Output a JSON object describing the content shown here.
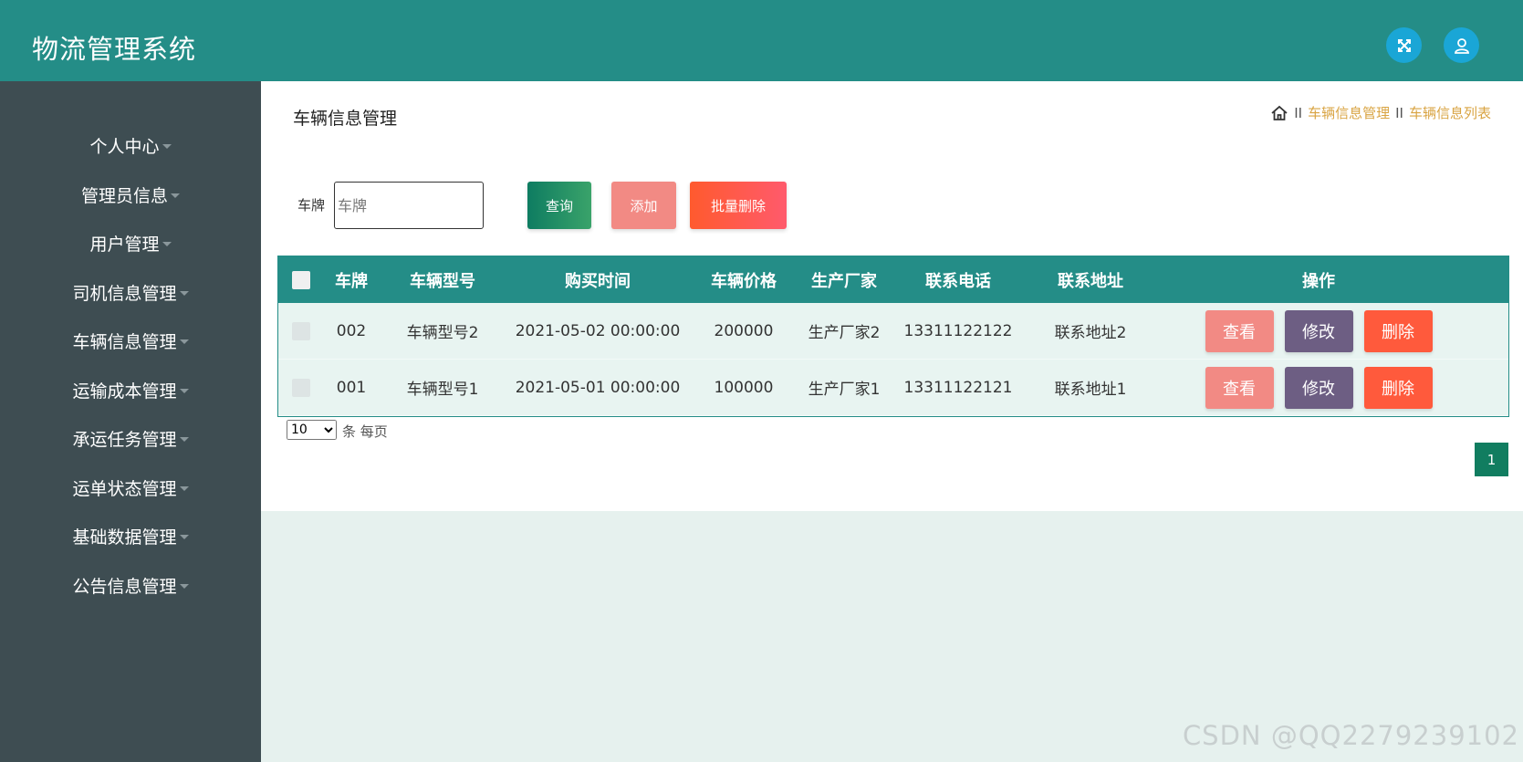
{
  "app": {
    "title": "物流管理系统"
  },
  "topbar": {
    "icons": [
      "fullscreen-icon",
      "user-icon"
    ]
  },
  "sidebar": {
    "items": [
      {
        "label": "个人中心"
      },
      {
        "label": "管理员信息"
      },
      {
        "label": "用户管理"
      },
      {
        "label": "司机信息管理"
      },
      {
        "label": "车辆信息管理"
      },
      {
        "label": "运输成本管理"
      },
      {
        "label": "承运任务管理"
      },
      {
        "label": "运单状态管理"
      },
      {
        "label": "基础数据管理"
      },
      {
        "label": "公告信息管理"
      }
    ]
  },
  "page": {
    "title": "车辆信息管理",
    "breadcrumb": {
      "separator": "II",
      "items": [
        "车辆信息管理",
        "车辆信息列表"
      ]
    }
  },
  "search": {
    "label": "车牌",
    "placeholder": "车牌",
    "value": "",
    "query_label": "查询",
    "add_label": "添加",
    "batch_delete_label": "批量删除"
  },
  "table": {
    "columns": [
      "车牌",
      "车辆型号",
      "购买时间",
      "车辆价格",
      "生产厂家",
      "联系电话",
      "联系地址",
      "操作"
    ],
    "rows": [
      {
        "plate": "002",
        "model": "车辆型号2",
        "purchase_time": "2021-05-02 00:00:00",
        "price": "200000",
        "maker": "生产厂家2",
        "phone": "13311122122",
        "address": "联系地址2"
      },
      {
        "plate": "001",
        "model": "车辆型号1",
        "purchase_time": "2021-05-01 00:00:00",
        "price": "100000",
        "maker": "生产厂家1",
        "phone": "13311122121",
        "address": "联系地址1"
      }
    ],
    "actions": {
      "view": "查看",
      "edit": "修改",
      "delete": "删除"
    }
  },
  "pagination": {
    "page_size": "10",
    "page_size_options": [
      "10"
    ],
    "per_page_text": "条 每页",
    "current_page": "1"
  },
  "watermark": "CSDN @QQ2279239102",
  "colors": {
    "header": "#248d87",
    "sidebar": "#3e4d52",
    "accent_link": "#d9a443",
    "query_button": "#0e7c61",
    "add_button": "#f28a84",
    "delete_button": "#ff5a3c",
    "edit_button": "#6d5e83"
  }
}
